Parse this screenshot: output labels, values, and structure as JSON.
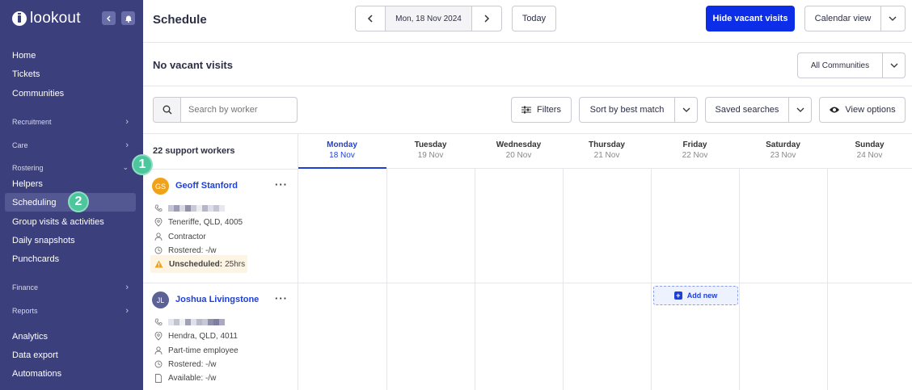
{
  "brand": {
    "name": "lookout"
  },
  "sidebar": {
    "items": [
      {
        "label": "Home"
      },
      {
        "label": "Tickets"
      },
      {
        "label": "Communities"
      },
      {
        "label": "Recruitment"
      },
      {
        "label": "Care"
      },
      {
        "label": "Rostering"
      },
      {
        "label": "Helpers"
      },
      {
        "label": "Scheduling"
      },
      {
        "label": "Group visits & activities"
      },
      {
        "label": "Daily snapshots"
      },
      {
        "label": "Punchcards"
      },
      {
        "label": "Finance"
      },
      {
        "label": "Reports"
      },
      {
        "label": "Analytics"
      },
      {
        "label": "Data export"
      },
      {
        "label": "Automations"
      }
    ],
    "badges": [
      "1",
      "2"
    ]
  },
  "header": {
    "title": "Schedule",
    "date_label": "Mon, 18 Nov 2024",
    "today_label": "Today",
    "hide_vacant_label": "Hide vacant visits",
    "calendar_view_label": "Calendar view"
  },
  "subheader": {
    "title": "No vacant visits",
    "communities_label": "All Communities"
  },
  "toolbar": {
    "search_placeholder": "Search by worker",
    "filters_label": "Filters",
    "sort_label": "Sort by best match",
    "saved_searches_label": "Saved searches",
    "view_options_label": "View options"
  },
  "grid": {
    "count_label": "22 support workers",
    "days": [
      {
        "day": "Monday",
        "date": "18 Nov"
      },
      {
        "day": "Tuesday",
        "date": "19 Nov"
      },
      {
        "day": "Wednesday",
        "date": "20 Nov"
      },
      {
        "day": "Thursday",
        "date": "21 Nov"
      },
      {
        "day": "Friday",
        "date": "22 Nov"
      },
      {
        "day": "Saturday",
        "date": "23 Nov"
      },
      {
        "day": "Sunday",
        "date": "24 Nov"
      }
    ],
    "add_new_label": "Add new"
  },
  "workers": [
    {
      "initials": "GS",
      "name": "Geoff Stanford",
      "address": "Teneriffe, QLD, 4005",
      "role": "Contractor",
      "rostered": "Rostered: -/w",
      "unscheduled_label": "Unscheduled:",
      "unscheduled_value": "25hrs",
      "avatar_color": "#f0a21a"
    },
    {
      "initials": "JL",
      "name": "Joshua Livingstone",
      "address": "Hendra, QLD, 4011",
      "role": "Part-time employee",
      "rostered": "Rostered: -/w",
      "available": "Available: -/w",
      "avatar_color": "#5c6196"
    }
  ],
  "colors": {
    "sidebar": "#3b3f7c",
    "primary": "#0c2ee8",
    "badge": "#4cc69d",
    "link": "#1e3fd9"
  }
}
